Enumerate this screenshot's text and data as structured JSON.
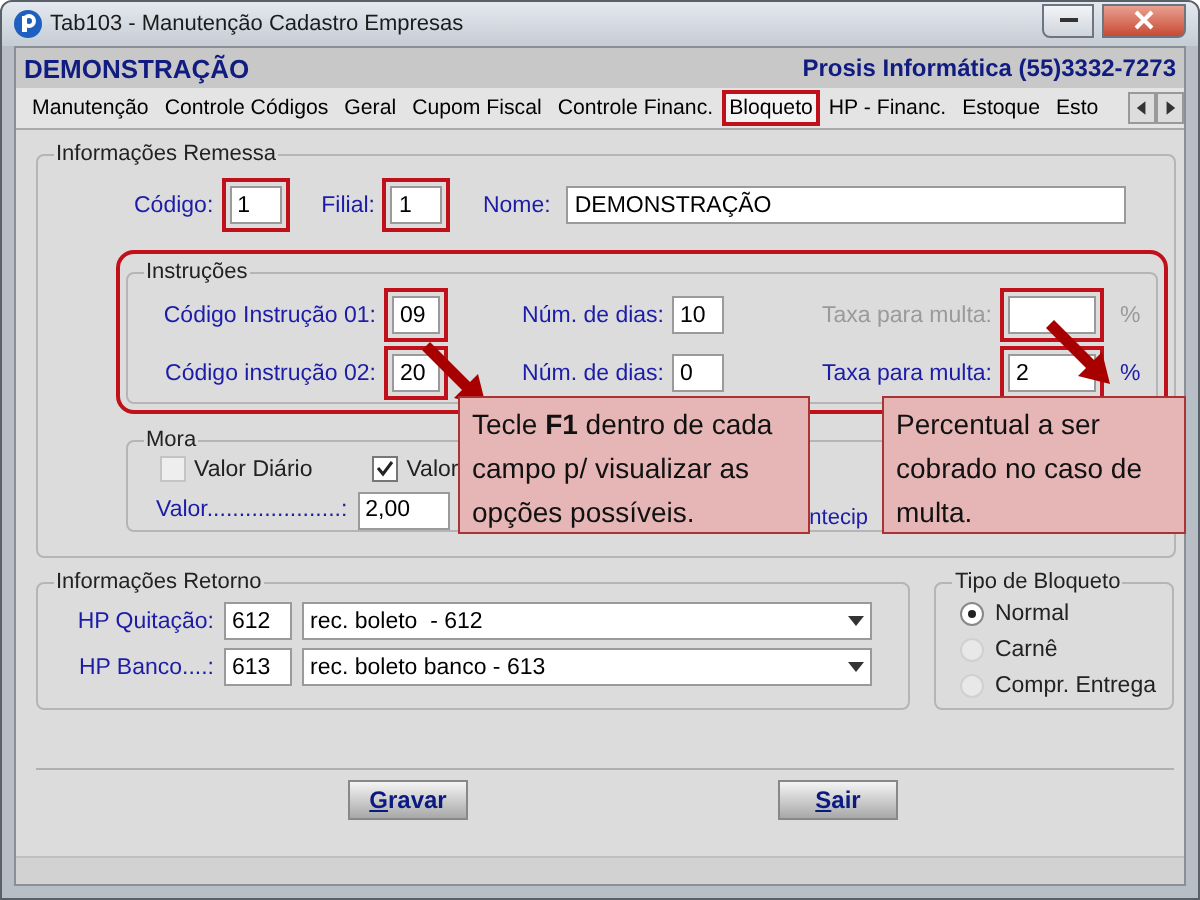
{
  "window": {
    "title": "Tab103 - Manutenção Cadastro Empresas"
  },
  "header": {
    "company": "DEMONSTRAÇÃO",
    "vendor": "Prosis Informática (55)3332-7273"
  },
  "tabs": [
    {
      "label": "Manutenção",
      "selected": false
    },
    {
      "label": "Controle Códigos",
      "selected": false
    },
    {
      "label": "Geral",
      "selected": false
    },
    {
      "label": "Cupom Fiscal",
      "selected": false
    },
    {
      "label": "Controle Financ.",
      "selected": false
    },
    {
      "label": "Bloqueto",
      "selected": true
    },
    {
      "label": "HP - Financ.",
      "selected": false
    },
    {
      "label": "Estoque",
      "selected": false
    },
    {
      "label": "Esto",
      "selected": false
    }
  ],
  "remessa": {
    "title": "Informações Remessa",
    "fields": [
      {
        "label": "Código:",
        "value": "1",
        "highlighted": true
      },
      {
        "label": "Filial:",
        "value": "1",
        "highlighted": true
      },
      {
        "label": "Nome:",
        "value": "DEMONSTRAÇÃO",
        "highlighted": false
      }
    ]
  },
  "instructions": {
    "title": "Instruções",
    "highlighted": true,
    "rows": [
      {
        "code_label": "Código Instrução 01:",
        "code": "09",
        "days_label": "Núm. de dias:",
        "days": "10",
        "rate_label": "Taxa para multa:",
        "unit": "%",
        "rate_disabled": true,
        "code_highlighted": true,
        "rate_highlighted": true
      },
      {
        "code_label": "Código instrução 02:",
        "code": "20",
        "days_label": "Núm. de dias:",
        "days": "0",
        "rate_label": "Taxa para multa:",
        "rate": "2",
        "unit": "%",
        "rate_disabled": false,
        "code_highlighted": true,
        "rate_highlighted": true
      }
    ]
  },
  "mora": {
    "title": "Mora",
    "options": [
      {
        "label": "Valor Diário",
        "checked": false
      },
      {
        "label": "Valor",
        "checked": true
      }
    ],
    "value_label": "Valor.....................:",
    "value": "2,00",
    "extra_label": "ntecip"
  },
  "retorno": {
    "title": "Informações Retorno",
    "rows": [
      {
        "label": "HP Quitação:",
        "code": "612",
        "description": "rec. boleto  - 612"
      },
      {
        "label": "HP Banco....:",
        "code": "613",
        "description": "rec. boleto banco - 613"
      }
    ]
  },
  "tipo": {
    "title": "Tipo de Bloqueto",
    "options": [
      {
        "label": "Normal",
        "selected": true
      },
      {
        "label": "Carnê",
        "selected": false
      },
      {
        "label": "Compr. Entrega",
        "selected": false
      }
    ]
  },
  "buttons": [
    "Gravar",
    "Sair"
  ],
  "callouts": [
    {
      "text": "Tecle **F1** dentro de cada campo p/ visualizar as opções possíveis."
    },
    {
      "text": "Percentual a ser cobrado no caso de multa."
    }
  ]
}
